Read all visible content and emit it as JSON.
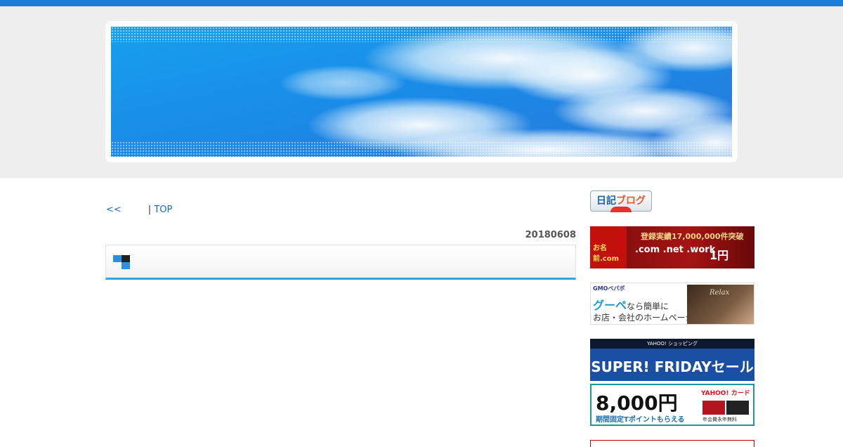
{
  "nav": {
    "prev_label": "<<",
    "separator": "|",
    "top_label": "TOP"
  },
  "post": {
    "date": "20180608",
    "title": ""
  },
  "sidebar": {
    "nikki_blog": {
      "part1": "日記",
      "part2": "ブログ"
    },
    "ad_onamae": {
      "logo": "お名前.com",
      "line1": "登録実績17,000,000件突破",
      "line2": ".com .net .work",
      "line3": "1円"
    },
    "ad_goope": {
      "brand": "GMOペパボ",
      "line1_main": "グーペ",
      "line1_sub": "なら簡単に",
      "line2": "お店・会社のホームページ作成!",
      "photo_text": "Relax"
    },
    "ad_yahoo": {
      "header": "YAHOO! ショッピング",
      "headline": "SUPER! FRIDAYセール",
      "amount": "8,000円",
      "sub": "期間固定Tポイントもらえる",
      "card_label": "YAHOO! カード",
      "card_note": "年会費永年無料"
    }
  },
  "colors": {
    "top_bar": "#1e7fd8",
    "accent_line": "#2ea7e0",
    "link": "#1a6db5"
  }
}
